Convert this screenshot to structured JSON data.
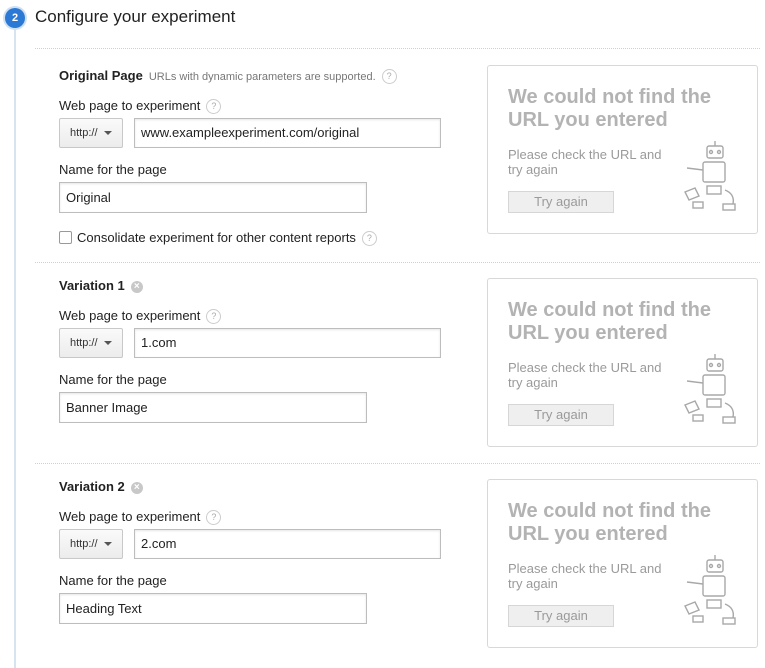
{
  "step": {
    "number": "2",
    "title": "Configure your experiment"
  },
  "help_glyph": "?",
  "remove_glyph": "×",
  "original": {
    "title": "Original Page",
    "note": "URLs with dynamic parameters are supported.",
    "url_label": "Web page to experiment",
    "protocol": "http://",
    "url": "www.exampleexperiment.com/original",
    "name_label": "Name for the page",
    "name": "Original",
    "consolidate_label": "Consolidate experiment for other content reports"
  },
  "variations": [
    {
      "title": "Variation 1",
      "url_label": "Web page to experiment",
      "protocol": "http://",
      "url": "1.com",
      "name_label": "Name for the page",
      "name": "Banner Image"
    },
    {
      "title": "Variation 2",
      "url_label": "Web page to experiment",
      "protocol": "http://",
      "url": "2.com",
      "name_label": "Name for the page",
      "name": "Heading Text"
    }
  ],
  "preview": {
    "title": "We could not find the URL you entered",
    "message": "Please check the URL and try again",
    "button": "Try again"
  },
  "icons": {
    "step": "step-number-badge",
    "help": "help-icon",
    "remove": "remove-icon",
    "dropdown": "chevron-down-icon",
    "robot": "broken-robot-icon"
  },
  "colors": {
    "accent": "#2b78d5",
    "preview_text": "#b3b3b3"
  }
}
